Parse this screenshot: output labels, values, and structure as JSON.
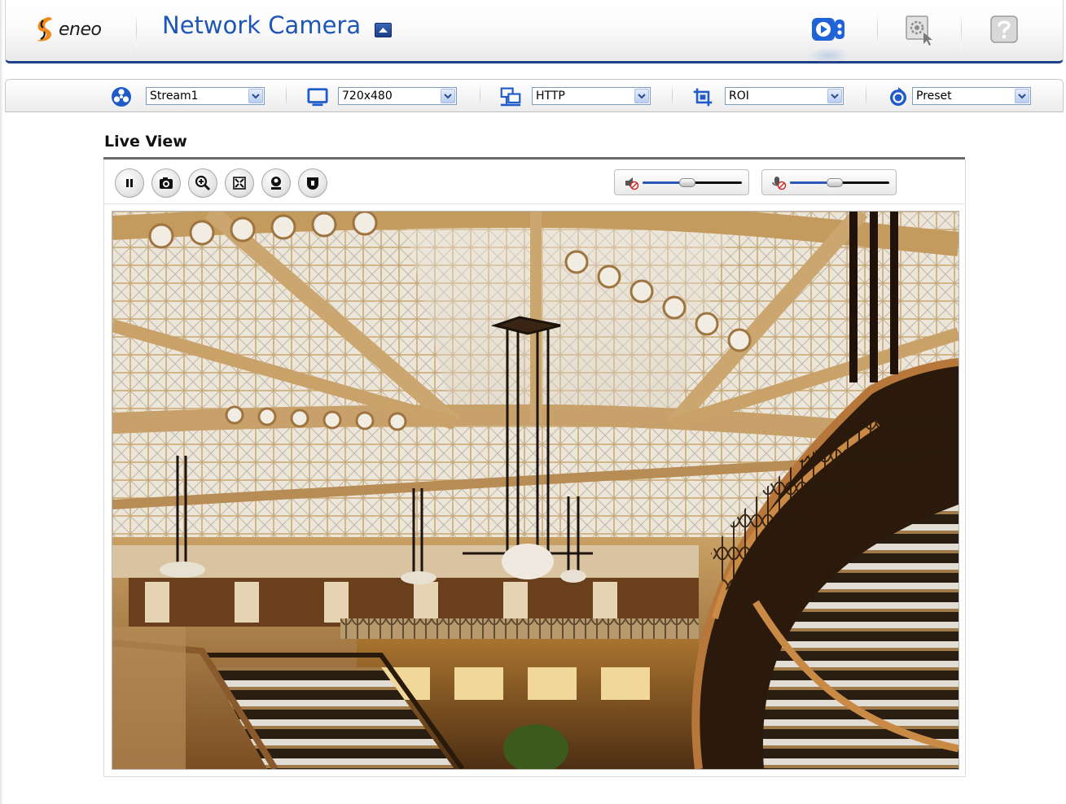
{
  "brand": {
    "logo_text": "eneo"
  },
  "app": {
    "title": "Network Camera"
  },
  "header_icons": [
    "live-view-icon",
    "settings-icon",
    "help-icon"
  ],
  "toolbar": {
    "stream": {
      "value": "Stream1",
      "icon": "stream-icon"
    },
    "resolution": {
      "value": "720x480",
      "icon": "monitor-icon"
    },
    "protocol": {
      "value": "HTTP",
      "icon": "network-icon"
    },
    "roi": {
      "value": "ROI",
      "icon": "roi-icon"
    },
    "preset": {
      "value": "Preset",
      "icon": "preset-icon"
    }
  },
  "live_view": {
    "title": "Live View",
    "controls": [
      "pause-icon",
      "snapshot-icon",
      "digital-zoom-icon",
      "fullscreen-icon",
      "talk-icon",
      "record-icon"
    ],
    "speaker_volume_level": 0.45,
    "microphone_volume_level": 0.45
  },
  "colors": {
    "brand_blue": "#1e55b6",
    "header_border": "#1f3f86",
    "logo_orange": "#f08a1c"
  }
}
